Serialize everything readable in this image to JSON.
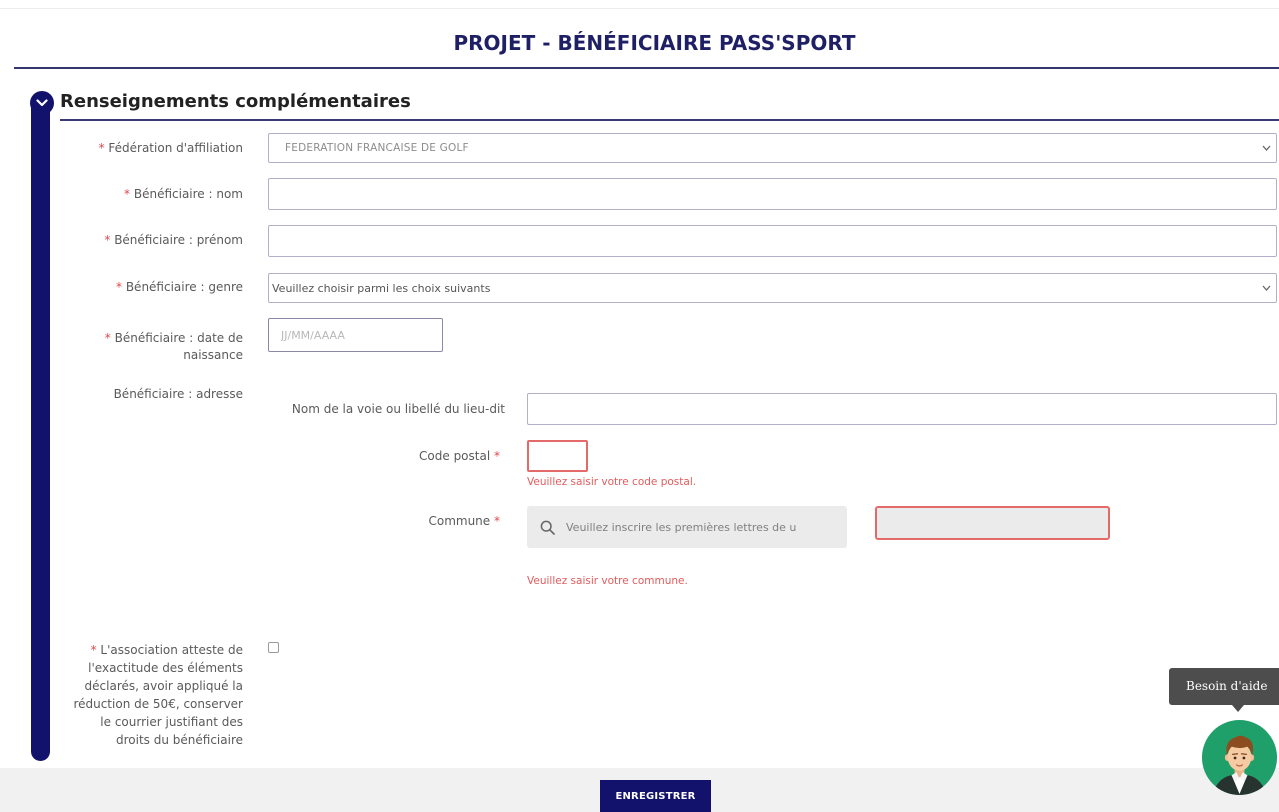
{
  "page": {
    "title": "PROJET - BÉNÉFICIAIRE PASS'SPORT"
  },
  "section": {
    "heading": "Renseignements complémentaires",
    "toggle_icon": "chevron-down-icon"
  },
  "form": {
    "federation": {
      "required_mark": "*",
      "label": "Fédération d'affiliation",
      "selected": "FEDERATION FRANCAISE DE GOLF",
      "icon": "chevron-down-icon"
    },
    "nom": {
      "required_mark": "*",
      "label": "Bénéficiaire : nom"
    },
    "prenom": {
      "required_mark": "*",
      "label": "Bénéficiaire : prénom"
    },
    "genre": {
      "required_mark": "*",
      "label": "Bénéficiaire : genre",
      "selected": "Veuillez choisir parmi les choix suivants",
      "icon": "chevron-down-icon"
    },
    "date_naissance": {
      "required_mark": "*",
      "label": "Bénéficiaire : date de naissance",
      "placeholder": "JJ/MM/AAAA"
    },
    "adresse": {
      "label": "Bénéficiaire : adresse",
      "voie": {
        "label": "Nom de la voie ou libellé du lieu-dit"
      },
      "code_postal": {
        "label": "Code postal",
        "required_mark": "*",
        "error": "Veuillez saisir votre code postal."
      },
      "commune": {
        "label": "Commune",
        "required_mark": "*",
        "search_icon": "search-icon",
        "search_placeholder": "Veuillez inscrire les premières lettres de u",
        "error": "Veuillez saisir votre commune."
      }
    },
    "attestation": {
      "required_mark": "*",
      "label": "L'association atteste de l'exactitude des éléments déclarés, avoir appliqué la réduction de 50€, conserver le courrier justifiant des droits du bénéficiaire",
      "checked": false
    }
  },
  "actions": {
    "save_label": "ENREGISTRER"
  },
  "help": {
    "tooltip": "Besoin d'aide",
    "avatar_icon": "assistant-avatar-icon"
  },
  "colors": {
    "brand_navy": "#12126c",
    "required_red": "#e0474c",
    "error_red": "#e25b5b",
    "help_green": "#1f9f69",
    "tooltip_gray": "#4d4d4d"
  }
}
